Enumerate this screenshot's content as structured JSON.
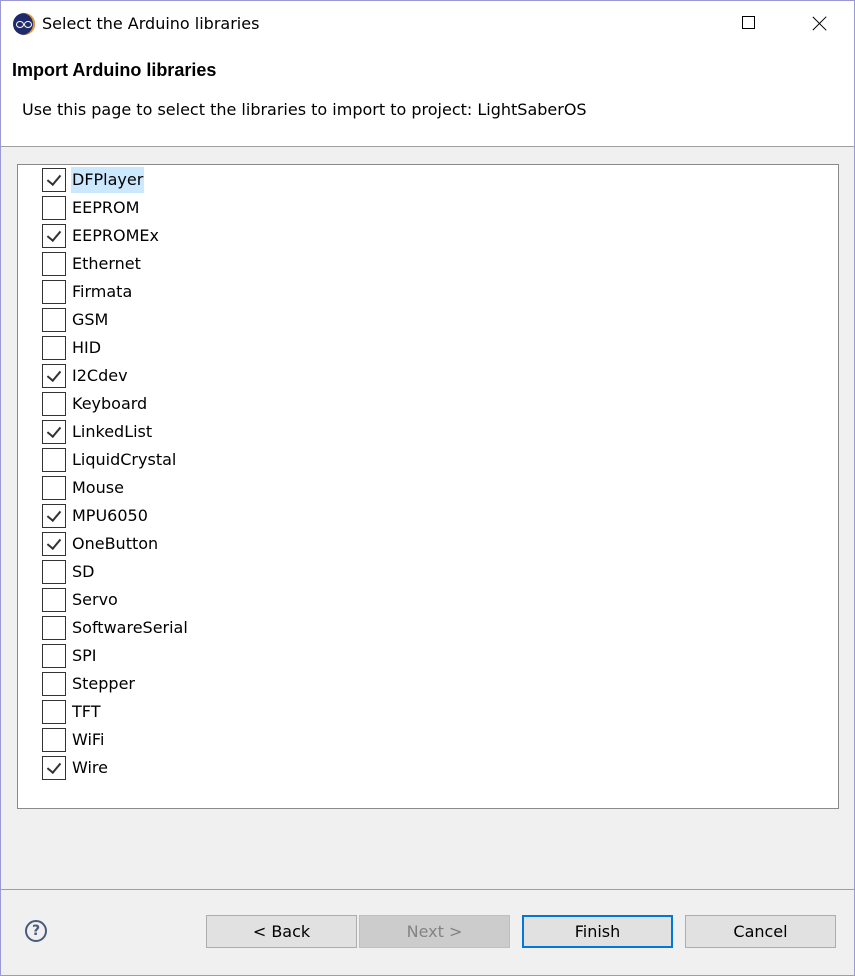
{
  "window": {
    "title": "Select the Arduino libraries",
    "icon": "arduino-eclipse-icon",
    "controls": {
      "maximize": "maximize-icon",
      "close": "close-icon"
    }
  },
  "header": {
    "title": "Import Arduino libraries",
    "description": "Use this page to select the libraries to import to project: LightSaberOS"
  },
  "libraries": [
    {
      "name": "DFPlayer",
      "checked": true,
      "selected": true
    },
    {
      "name": "EEPROM",
      "checked": false
    },
    {
      "name": "EEPROMEx",
      "checked": true
    },
    {
      "name": "Ethernet",
      "checked": false
    },
    {
      "name": "Firmata",
      "checked": false
    },
    {
      "name": "GSM",
      "checked": false
    },
    {
      "name": "HID",
      "checked": false
    },
    {
      "name": "I2Cdev",
      "checked": true
    },
    {
      "name": "Keyboard",
      "checked": false
    },
    {
      "name": "LinkedList",
      "checked": true
    },
    {
      "name": "LiquidCrystal",
      "checked": false
    },
    {
      "name": "Mouse",
      "checked": false
    },
    {
      "name": "MPU6050",
      "checked": true
    },
    {
      "name": "OneButton",
      "checked": true
    },
    {
      "name": "SD",
      "checked": false
    },
    {
      "name": "Servo",
      "checked": false
    },
    {
      "name": "SoftwareSerial",
      "checked": false
    },
    {
      "name": "SPI",
      "checked": false
    },
    {
      "name": "Stepper",
      "checked": false
    },
    {
      "name": "TFT",
      "checked": false
    },
    {
      "name": "WiFi",
      "checked": false
    },
    {
      "name": "Wire",
      "checked": true
    }
  ],
  "footer": {
    "help_icon": "?",
    "back_label": "< Back",
    "next_label": "Next >",
    "finish_label": "Finish",
    "cancel_label": "Cancel",
    "next_enabled": false,
    "default_button": "finish"
  },
  "colors": {
    "accent": "#0078d7",
    "selection": "#cce8ff",
    "window_border": "#9a99d6"
  }
}
